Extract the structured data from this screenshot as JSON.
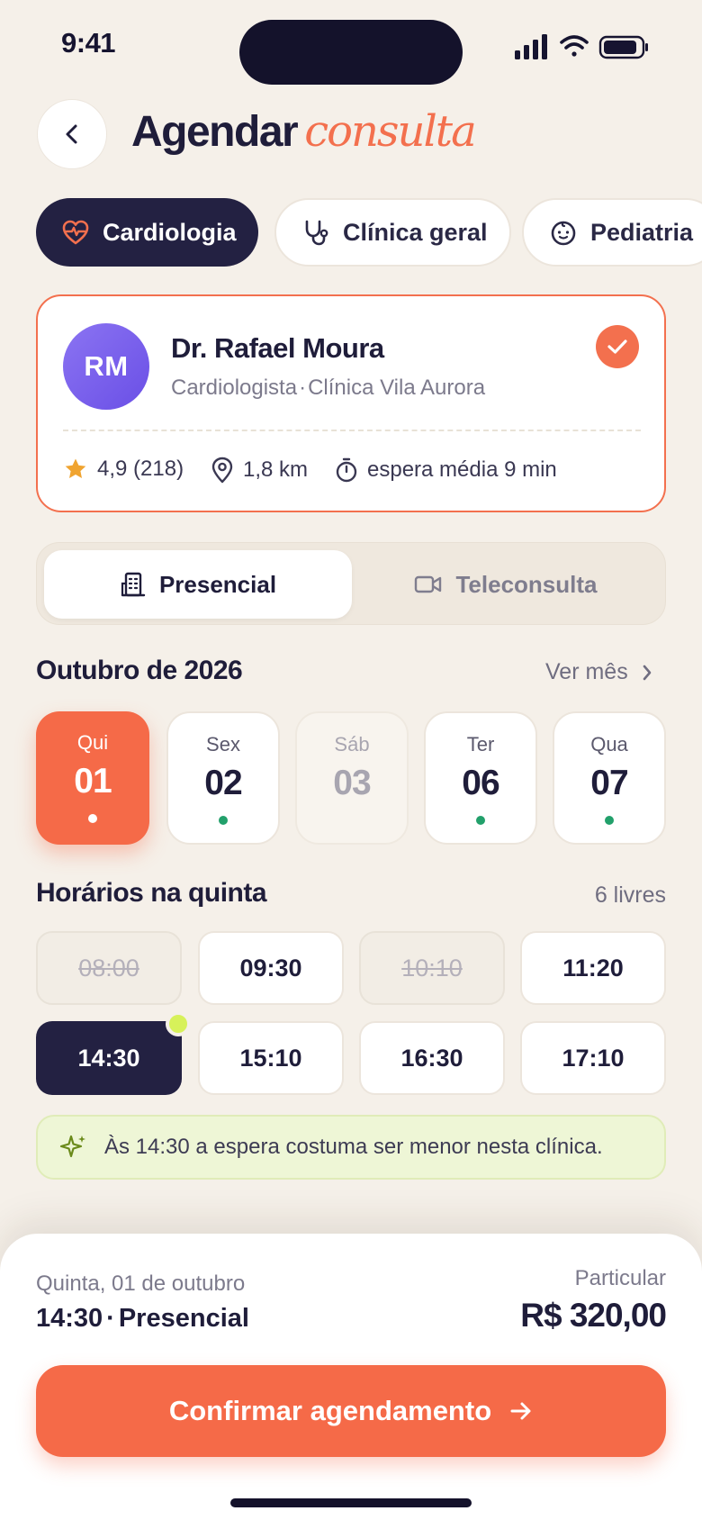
{
  "status_bar": {
    "time": "9:41"
  },
  "header": {
    "title": "Agendar",
    "title_accent": "consulta",
    "back_icon": "chevron-left-icon"
  },
  "specialties": [
    {
      "label": "Cardiologia",
      "icon": "heart-pulse-icon",
      "active": true
    },
    {
      "label": "Clínica geral",
      "icon": "stethoscope-icon",
      "active": false
    },
    {
      "label": "Pediatria",
      "icon": "baby-face-icon",
      "active": false
    }
  ],
  "doctor": {
    "initials": "RM",
    "name": "Dr. Rafael Moura",
    "specialty": "Cardiologista",
    "separator": "·",
    "clinic": "Clínica Vila Aurora",
    "rating": "4,9 (218)",
    "distance": "1,8 km",
    "wait": "espera média 9 min",
    "selected": true
  },
  "mode": {
    "options": [
      "Presencial",
      "Teleconsulta"
    ],
    "selected": "Presencial"
  },
  "calendar": {
    "month_label": "Outubro de 2026",
    "see_month": "Ver mês",
    "days": [
      {
        "weekday": "Qui",
        "day": "01",
        "state": "selected"
      },
      {
        "weekday": "Sex",
        "day": "02",
        "state": "available"
      },
      {
        "weekday": "Sáb",
        "day": "03",
        "state": "unavailable"
      },
      {
        "weekday": "Ter",
        "day": "06",
        "state": "available"
      },
      {
        "weekday": "Qua",
        "day": "07",
        "state": "available"
      }
    ]
  },
  "times": {
    "title": "Horários na quinta",
    "free_count": "6 livres",
    "slots": [
      {
        "time": "08:00",
        "state": "taken"
      },
      {
        "time": "09:30",
        "state": "free"
      },
      {
        "time": "10:10",
        "state": "taken"
      },
      {
        "time": "11:20",
        "state": "free"
      },
      {
        "time": "14:30",
        "state": "selected"
      },
      {
        "time": "15:10",
        "state": "free"
      },
      {
        "time": "16:30",
        "state": "free"
      },
      {
        "time": "17:10",
        "state": "free"
      }
    ]
  },
  "tip": {
    "text": "Às 14:30 a espera costuma ser menor nesta clínica.",
    "icon": "sparkle-icon"
  },
  "summary": {
    "date": "Quinta, 01 de outubro",
    "time": "14:30",
    "separator": "·",
    "mode": "Presencial",
    "payment_type": "Particular",
    "price": "R$ 320,00",
    "confirm_label": "Confirmar agendamento"
  },
  "colors": {
    "accent": "#f56a48",
    "navy": "#232142",
    "background": "#f5f0e9",
    "available_dot": "#22a06b",
    "tip_bg": "#eef6d6"
  }
}
